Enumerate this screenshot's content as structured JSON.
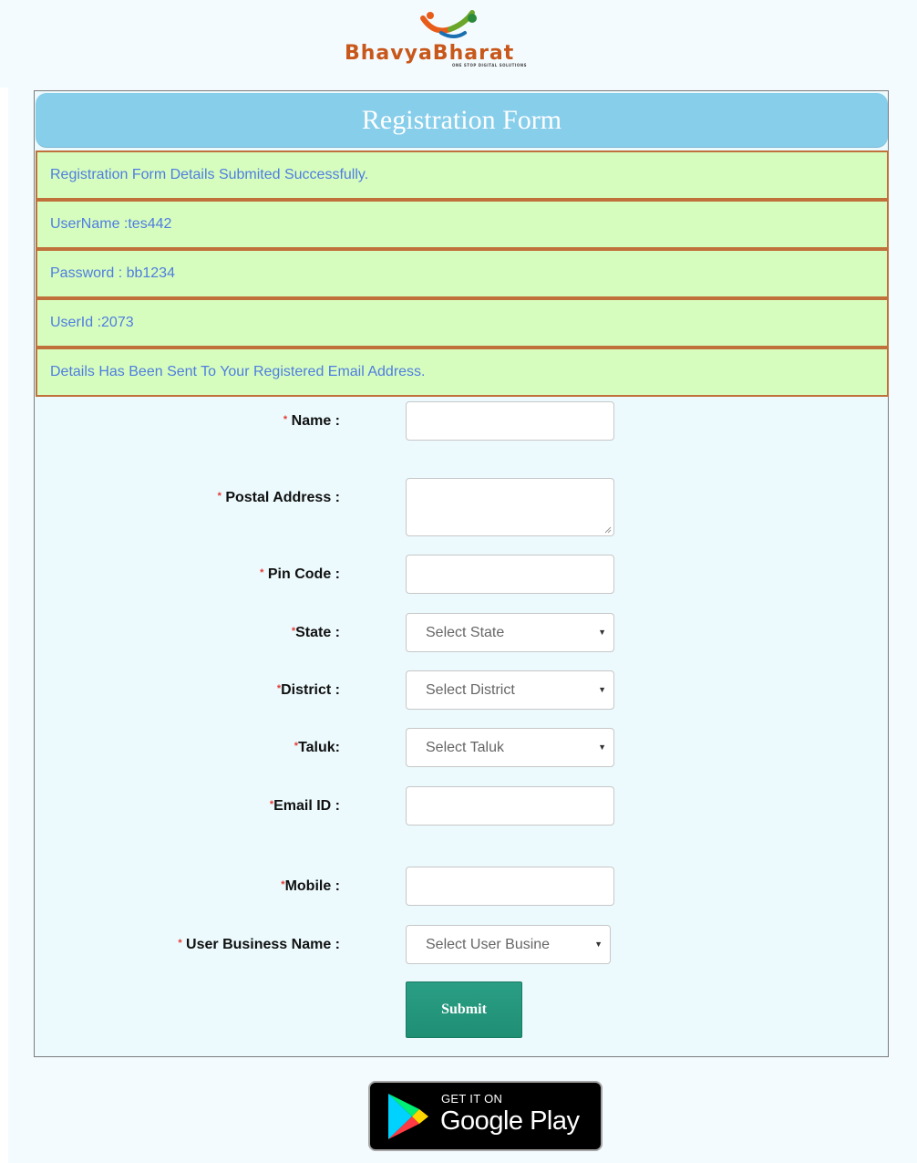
{
  "logo": {
    "brand": "BhavyaBharat",
    "tagline": "ONE STOP DIGITAL SOLUTIONS"
  },
  "form": {
    "title": "Registration Form",
    "messages": [
      "Registration Form Details Submited Successfully.",
      "UserName :tes442",
      "Password :  bb1234",
      "UserId :2073",
      "Details Has Been Sent To Your Registered Email Address."
    ],
    "fields": {
      "name": {
        "required": "*",
        "label": " Name :",
        "value": ""
      },
      "postal_address": {
        "required": "*",
        "label": " Postal Address :",
        "value": ""
      },
      "pin_code": {
        "required": "*",
        "label": " Pin Code :",
        "value": ""
      },
      "state": {
        "required": "*",
        "label": "State :",
        "selected": "Select State"
      },
      "district": {
        "required": "*",
        "label": "District :",
        "selected": "Select District"
      },
      "taluk": {
        "required": "*",
        "label": "Taluk:",
        "selected": "Select Taluk"
      },
      "email": {
        "required": "*",
        "label": "Email ID :",
        "value": ""
      },
      "mobile": {
        "required": "*",
        "label": "Mobile :",
        "value": ""
      },
      "business": {
        "required": "*",
        "label": " User Business Name :",
        "selected": "Select User Busine"
      }
    },
    "submit_label": "Submit"
  },
  "store_badge": {
    "line1": "GET IT ON",
    "line2": "Google Play"
  },
  "colors": {
    "header": "#87ceeb",
    "message_bg": "#d7fdbe",
    "message_text": "#4e7de0",
    "message_border": "#c0703a",
    "required": "#e53935",
    "submit": "#2a9e85"
  }
}
